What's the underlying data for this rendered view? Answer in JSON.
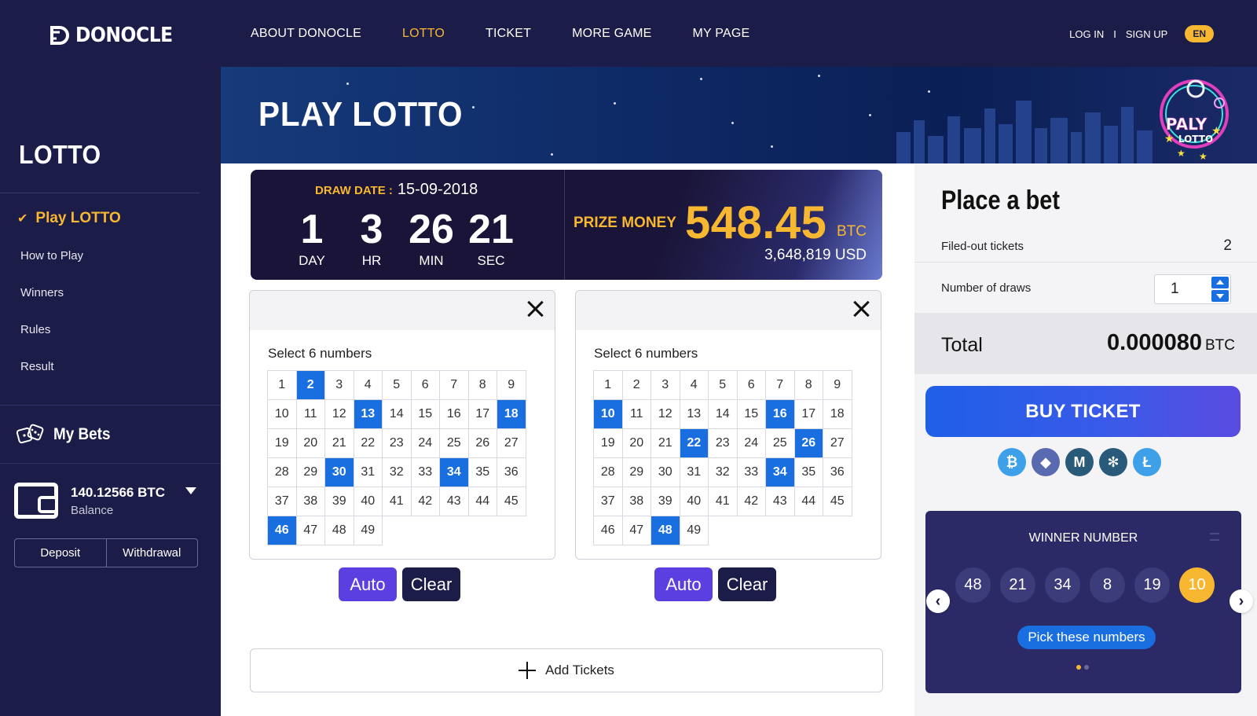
{
  "brand": {
    "name": "DONOCLE"
  },
  "nav": {
    "links": [
      "ABOUT DONOCLE",
      "LOTTO",
      "TICKET",
      "MORE GAME",
      "MY PAGE"
    ],
    "login": "LOG IN",
    "separator": "I",
    "signup": "SIGN UP",
    "lang": "EN"
  },
  "sidebar": {
    "title": "LOTTO",
    "items": [
      "Play LOTTO",
      "How to Play",
      "Winners",
      "Rules",
      "Result"
    ],
    "mybets_label": "My Bets",
    "wallet_amount": "140.12566 BTC",
    "wallet_sub": "Balance",
    "deposit": "Deposit",
    "withdrawal": "Withdrawal"
  },
  "banner": {
    "title": "PLAY LOTTO",
    "badge_top": "PALY",
    "badge_bottom": "LOTTO"
  },
  "draw": {
    "date_label": "DRAW DATE :",
    "date": "15-09-2018",
    "countdown": [
      {
        "num": "1",
        "unit": "DAY"
      },
      {
        "num": "3",
        "unit": "HR"
      },
      {
        "num": "26",
        "unit": "MIN"
      },
      {
        "num": "21",
        "unit": "SEC"
      }
    ],
    "prize_label": "PRIZE MONEY",
    "prize_amount": "548.45",
    "prize_unit": "BTC",
    "prize_usd": "3,648,819 USD"
  },
  "tickets": [
    {
      "subtitle": "Select 6 numbers",
      "selected": [
        2,
        13,
        18,
        30,
        34,
        46
      ],
      "auto": "Auto",
      "clear": "Clear"
    },
    {
      "subtitle": "Select 6 numbers",
      "selected": [
        10,
        16,
        22,
        26,
        34,
        48
      ],
      "auto": "Auto",
      "clear": "Clear"
    }
  ],
  "numbers_max": 49,
  "add_tickets": "Add Tickets",
  "bet": {
    "title": "Place a bet",
    "filled_label": "Filed-out tickets",
    "filled_value": "2",
    "draws_label": "Number of draws",
    "draws_value": "1",
    "total_label": "Total",
    "total_value": "0.000080",
    "total_unit": "BTC",
    "buy": "BUY TICKET",
    "coins": [
      {
        "name": "bitcoin-icon",
        "glyph": "₿",
        "color": "#3da0e8"
      },
      {
        "name": "ethereum-icon",
        "glyph": "◆",
        "color": "#5a6ab0"
      },
      {
        "name": "monero-icon",
        "glyph": "M",
        "color": "#2a5a7a"
      },
      {
        "name": "ripple-icon",
        "glyph": "✻",
        "color": "#2a5a7a"
      },
      {
        "name": "litecoin-icon",
        "glyph": "Ł",
        "color": "#3da0e8"
      }
    ]
  },
  "winner": {
    "title": "WINNER NUMBER",
    "balls": [
      "48",
      "21",
      "34",
      "8",
      "19",
      "10"
    ],
    "pick": "Pick these numbers"
  },
  "colors": {
    "navy": "#1c1c49",
    "gold": "#f7b731",
    "blue": "#1a6fe0",
    "purple": "#5b3fe0"
  }
}
